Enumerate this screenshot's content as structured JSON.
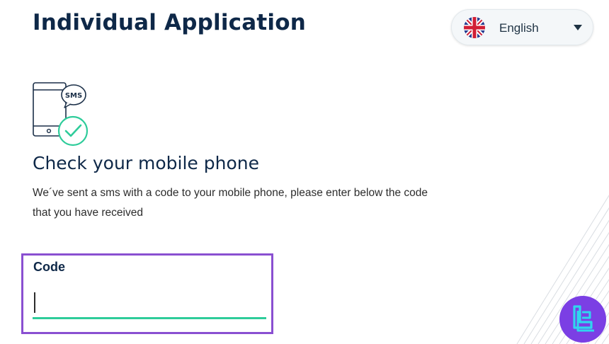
{
  "header": {
    "title": "Individual Application"
  },
  "language_selector": {
    "selected": "English",
    "flag_icon": "uk-flag-icon",
    "caret_icon": "chevron-down-icon"
  },
  "illustration": {
    "icon": "phone-sms-check-icon",
    "bubble_text": "SMS"
  },
  "main": {
    "heading": "Check your mobile phone",
    "instructions": "We´ve sent a sms with a code to your mobile phone, please enter below the code that you have received"
  },
  "code_field": {
    "label": "Code",
    "value": "",
    "placeholder": ""
  },
  "colors": {
    "title": "#0e2848",
    "accent_green": "#2ecc9a",
    "highlight_purple": "#8a4fd1",
    "logo_purple": "#7b3fe4",
    "logo_cyan": "#2fd6ee"
  }
}
